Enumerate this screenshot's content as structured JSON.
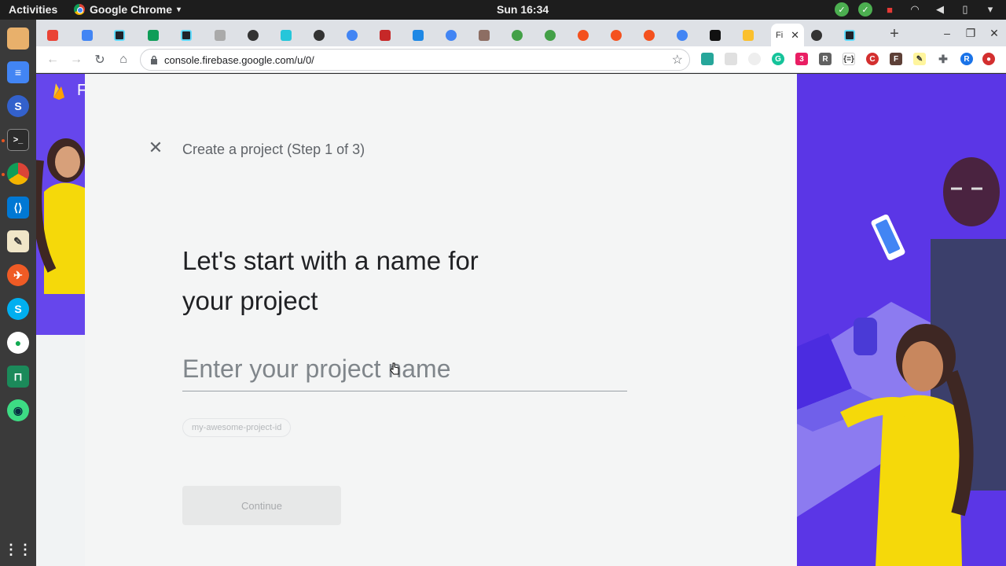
{
  "topbar": {
    "activities": "Activities",
    "app_name": "Google Chrome",
    "clock": "Sun 16:34"
  },
  "tabs": {
    "active_title": "Fi"
  },
  "toolbar": {
    "url": "console.firebase.google.com/u/0/"
  },
  "page": {
    "step_title": "Create a project (Step 1 of 3)",
    "headline_line1": "Let's start with a name for",
    "headline_line2": "your project",
    "input_placeholder": "Enter your project name",
    "project_id_chip": "my-awesome-project-id",
    "continue_label": "Continue",
    "brand_letter": "F"
  },
  "colors": {
    "accent": "#5b36e6",
    "firebase_orange": "#ffa000"
  }
}
